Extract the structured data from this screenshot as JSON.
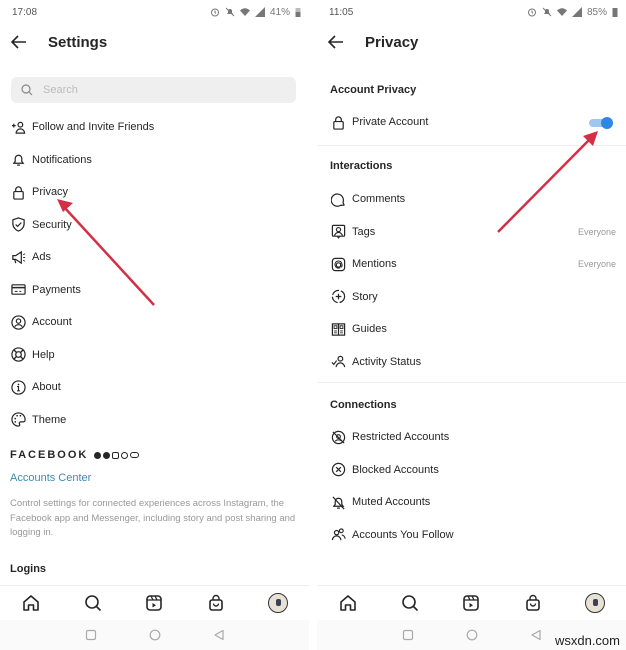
{
  "left": {
    "status": {
      "time": "17:08",
      "battery": "41%"
    },
    "header": {
      "title": "Settings",
      "back_icon": "arrow-left-icon"
    },
    "search": {
      "placeholder": "Search",
      "icon": "search-icon"
    },
    "menu": [
      {
        "label": "Follow and Invite Friends",
        "icon": "add-person-icon"
      },
      {
        "label": "Notifications",
        "icon": "bell-icon"
      },
      {
        "label": "Privacy",
        "icon": "lock-icon"
      },
      {
        "label": "Security",
        "icon": "shield-check-icon"
      },
      {
        "label": "Ads",
        "icon": "megaphone-icon"
      },
      {
        "label": "Payments",
        "icon": "card-icon"
      },
      {
        "label": "Account",
        "icon": "person-circle-icon"
      },
      {
        "label": "Help",
        "icon": "lifebuoy-icon"
      },
      {
        "label": "About",
        "icon": "info-icon"
      },
      {
        "label": "Theme",
        "icon": "palette-icon"
      }
    ],
    "facebook": {
      "brand": "FACEBOOK",
      "accounts_center": "Accounts Center",
      "description": "Control settings for connected experiences across Instagram, the Facebook app and Messenger, including story and post sharing and logging in."
    },
    "logins_title": "Logins"
  },
  "right": {
    "status": {
      "time": "11:05",
      "battery": "85%"
    },
    "header": {
      "title": "Privacy",
      "back_icon": "arrow-left-icon"
    },
    "account_privacy": {
      "title": "Account Privacy",
      "private_account": {
        "label": "Private Account",
        "enabled": true
      }
    },
    "interactions": {
      "title": "Interactions",
      "items": [
        {
          "label": "Comments",
          "value": "",
          "icon": "comment-icon"
        },
        {
          "label": "Tags",
          "value": "Everyone",
          "icon": "tag-person-icon"
        },
        {
          "label": "Mentions",
          "value": "Everyone",
          "icon": "at-sign-icon"
        },
        {
          "label": "Story",
          "value": "",
          "icon": "story-add-icon"
        },
        {
          "label": "Guides",
          "value": "",
          "icon": "guides-icon"
        },
        {
          "label": "Activity Status",
          "value": "",
          "icon": "activity-status-icon"
        }
      ]
    },
    "connections": {
      "title": "Connections",
      "items": [
        {
          "label": "Restricted Accounts",
          "icon": "restricted-icon"
        },
        {
          "label": "Blocked Accounts",
          "icon": "blocked-icon"
        },
        {
          "label": "Muted Accounts",
          "icon": "muted-bell-icon"
        },
        {
          "label": "Accounts You Follow",
          "icon": "people-icon"
        }
      ]
    }
  },
  "tabbar": [
    "home",
    "search",
    "reels",
    "shop",
    "profile"
  ],
  "watermark": "wsxdn.com",
  "colors": {
    "accent_link": "#3b8dab",
    "toggle_on": "#2f87e5",
    "annotation_arrow": "#d32f45"
  }
}
